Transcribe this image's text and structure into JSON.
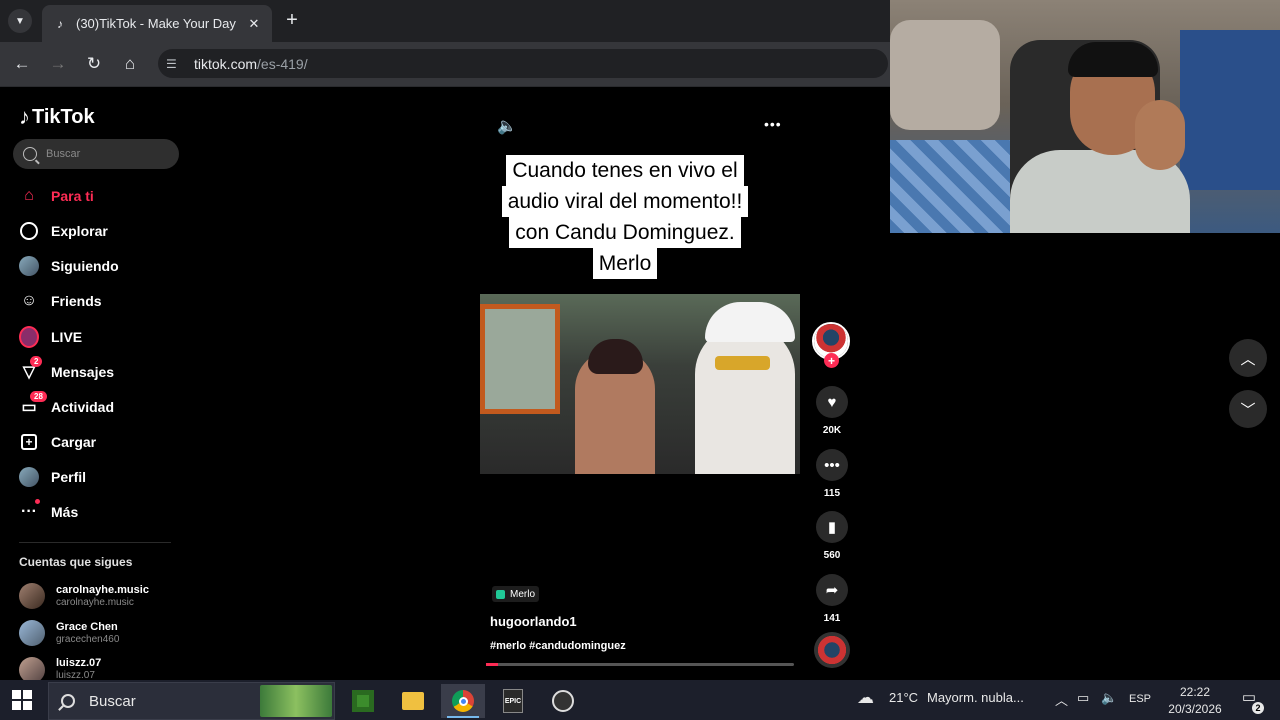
{
  "browser": {
    "tab_title": "(30)TikTok - Make Your Day",
    "tab_icon": "tiktok-icon",
    "url_host": "tiktok.com",
    "url_path": "/es-419/"
  },
  "sidebar": {
    "logo": "TikTok",
    "search_placeholder": "Buscar",
    "items": [
      {
        "label": "Para ti",
        "icon": "home-icon",
        "active": true
      },
      {
        "label": "Explorar",
        "icon": "compass-icon"
      },
      {
        "label": "Siguiendo",
        "icon": "following-avatar-icon"
      },
      {
        "label": "Friends",
        "icon": "friends-icon"
      },
      {
        "label": "LIVE",
        "icon": "live-icon"
      },
      {
        "label": "Mensajes",
        "icon": "messages-icon",
        "badge": "2"
      },
      {
        "label": "Actividad",
        "icon": "activity-icon",
        "badge": "28"
      },
      {
        "label": "Cargar",
        "icon": "upload-icon"
      },
      {
        "label": "Perfil",
        "icon": "profile-icon"
      },
      {
        "label": "Más",
        "icon": "more-icon"
      }
    ],
    "following_title": "Cuentas que sigues",
    "following": [
      {
        "name": "carolnayhe.music",
        "handle": "carolnayhe.music"
      },
      {
        "name": "Grace Chen",
        "handle": "gracechen460"
      },
      {
        "name": "luiszz.07",
        "handle": "luiszz.07"
      }
    ]
  },
  "video": {
    "caption_lines": [
      "Cuando tenes en vivo el",
      "audio viral del momento!!",
      "con Candu Dominguez.",
      "Merlo"
    ],
    "location": "Merlo",
    "author": "hugoorlando1",
    "hashtags": "#merlo #candudominguez",
    "progress": 0.04,
    "likes": "20K",
    "comments": "115",
    "saves": "560",
    "shares": "141"
  },
  "colors": {
    "accent": "#fe2c55",
    "taskbar": "#1c1f2b"
  },
  "taskbar": {
    "search_placeholder": "Buscar",
    "weather_temp": "21°C",
    "weather_text": "Mayorm. nubla...",
    "language": "ESP",
    "time": "22:22",
    "date": "20/3/2026",
    "notifications": "2"
  }
}
